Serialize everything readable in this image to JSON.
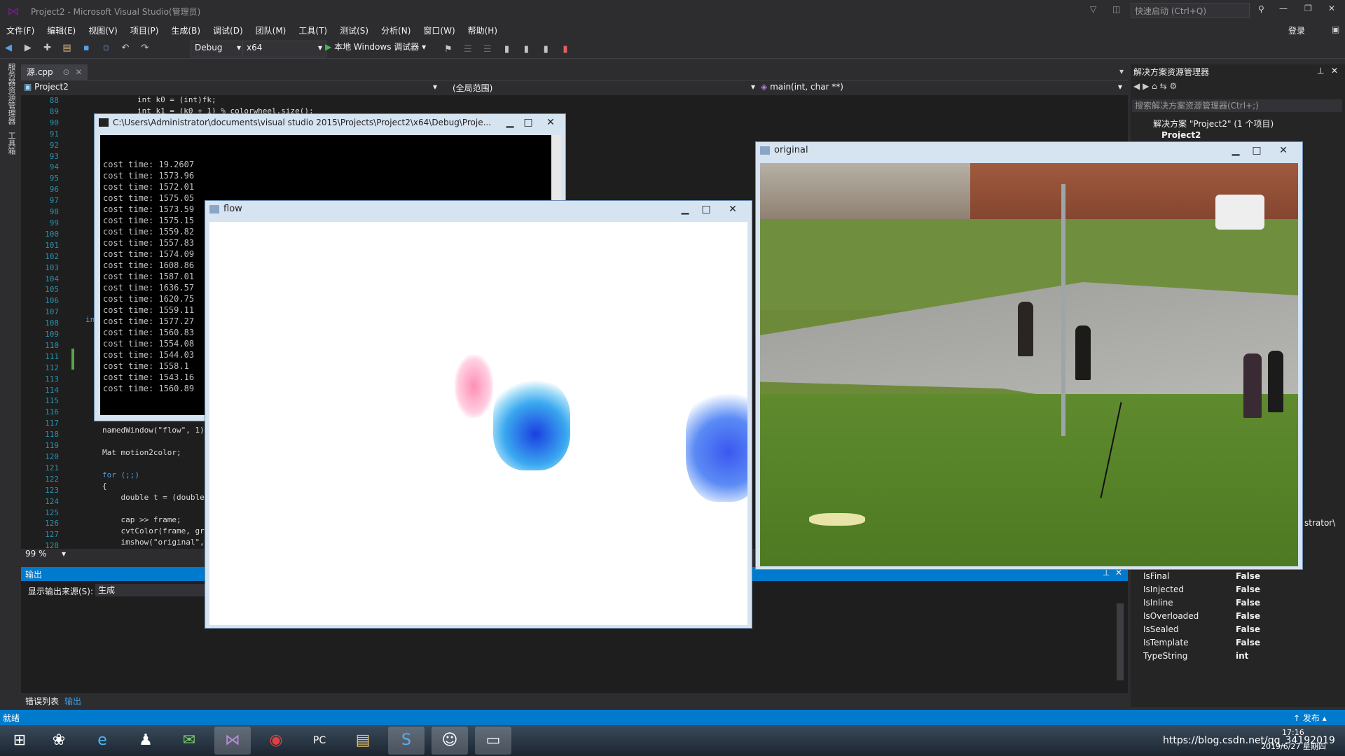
{
  "app": {
    "title": "Project2 - Microsoft Visual Studio(管理员)",
    "quick_launch_placeholder": "快速启动 (Ctrl+Q)",
    "login": "登录"
  },
  "menu": [
    "文件(F)",
    "编辑(E)",
    "视图(V)",
    "项目(P)",
    "生成(B)",
    "调试(D)",
    "团队(M)",
    "工具(T)",
    "测试(S)",
    "分析(N)",
    "窗口(W)",
    "帮助(H)"
  ],
  "toolbar": {
    "config": "Debug",
    "platform": "x64",
    "run_label": "本地 Windows 调试器"
  },
  "left_sidebar": [
    "服务器资源管理器",
    "工具箱"
  ],
  "editor": {
    "tab": "源.cpp",
    "project": "Project2",
    "scope": "(全局范围)",
    "function": "main(int, char **)",
    "zoom": "99 %",
    "line_numbers": [
      "88",
      "89",
      "90",
      "91",
      "92",
      "93",
      "94",
      "95",
      "96",
      "97",
      "98",
      "99",
      "100",
      "101",
      "102",
      "103",
      "104",
      "105",
      "106",
      "107",
      "108",
      "109",
      "110",
      "111",
      "112",
      "113",
      "114",
      "115",
      "116",
      "117",
      "118",
      "119",
      "120",
      "121",
      "122",
      "123",
      "124",
      "125",
      "126",
      "127",
      "128"
    ],
    "code_top": [
      "int k0 = (int)fk;",
      "int k1 = (k0 + 1) % colorwheel.size();"
    ],
    "code_bottom": [
      {
        "line": "118",
        "text": "namedWindow(\"flow\", 1)"
      },
      {
        "line": "120",
        "text": "Mat motion2color;"
      },
      {
        "line": "122",
        "text": "for (;;)"
      },
      {
        "line": "123",
        "text": "{"
      },
      {
        "line": "124",
        "text": "    double t = (double)"
      },
      {
        "line": "126",
        "text": "    cap >> frame;"
      },
      {
        "line": "127",
        "text": "    cvtColor(frame, gra"
      },
      {
        "line": "128",
        "text": "    imshow(\"original\","
      }
    ],
    "gutter_fragment": "in"
  },
  "output": {
    "tab_label": "输出",
    "source_label": "显示输出来源(S):",
    "source_value": "生成",
    "bottom_tabs": [
      "错误列表",
      "输出"
    ]
  },
  "solution_explorer": {
    "title": "解决方案资源管理器",
    "search_placeholder": "搜索解决方案资源管理器(Ctrl+;)",
    "solution": "解决方案 \"Project2\" (1 个项目)",
    "project": "Project2",
    "truncated": "strator\\"
  },
  "properties": [
    {
      "key": "IsFinal",
      "value": "False"
    },
    {
      "key": "IsInjected",
      "value": "False"
    },
    {
      "key": "IsInline",
      "value": "False"
    },
    {
      "key": "IsOverloaded",
      "value": "False"
    },
    {
      "key": "IsSealed",
      "value": "False"
    },
    {
      "key": "IsTemplate",
      "value": "False"
    },
    {
      "key": "TypeString",
      "value": "int"
    }
  ],
  "console": {
    "title": "C:\\Users\\Administrator\\documents\\visual studio 2015\\Projects\\Project2\\x64\\Debug\\Proje...",
    "lines": [
      "cost time: 19.2607",
      "cost time: 1573.96",
      "cost time: 1572.01",
      "cost time: 1575.05",
      "cost time: 1573.59",
      "cost time: 1575.15",
      "cost time: 1559.82",
      "cost time: 1557.83",
      "cost time: 1574.09",
      "cost time: 1608.86",
      "cost time: 1587.01",
      "cost time: 1636.57",
      "cost time: 1620.75",
      "cost time: 1559.11",
      "cost time: 1577.27",
      "cost time: 1560.83",
      "cost time: 1554.08",
      "cost time: 1544.03",
      "cost time: 1558.1",
      "cost time: 1543.16",
      "cost time: 1560.89"
    ]
  },
  "flow_window": {
    "title": "flow"
  },
  "original_window": {
    "title": "original"
  },
  "status": {
    "left": "就绪",
    "right": "↑ 发布 ▴"
  },
  "tray": {
    "time": "17:16",
    "date": "2019/6/27 星期四",
    "watermark": "https://blog.csdn.net/qq_34192019"
  },
  "colors": {
    "accent": "#007acc",
    "editor_bg": "#1e1e1e",
    "chrome_bg": "#2d2d30"
  }
}
